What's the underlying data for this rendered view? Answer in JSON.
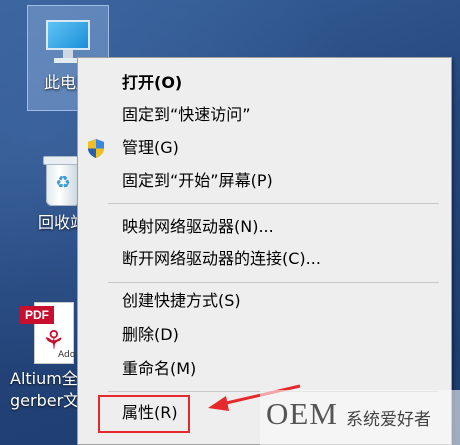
{
  "desktop": {
    "icons": [
      {
        "label": "此电脑",
        "name": "this-pc"
      },
      {
        "label": "回收站",
        "name": "recycle-bin"
      },
      {
        "label": "Altium全",
        "label2": "gerber文",
        "name": "pdf-file",
        "badge": "PDF",
        "subtext": "Ado"
      }
    ]
  },
  "context_menu": {
    "items": [
      {
        "label": "打开(O)",
        "bold": true
      },
      {
        "label": "固定到“快速访问”"
      },
      {
        "label": "管理(G)",
        "icon": "uac-shield-icon"
      },
      {
        "label": "固定到“开始”屏幕(P)"
      },
      {
        "label": "映射网络驱动器(N)..."
      },
      {
        "label": "断开网络驱动器的连接(C)..."
      },
      {
        "label": "创建快捷方式(S)"
      },
      {
        "label": "删除(D)"
      },
      {
        "label": "重命名(M)"
      },
      {
        "label": "属性(R)",
        "highlighted": true
      }
    ]
  },
  "annotation": {
    "highlight_color": "#e5292c"
  },
  "watermark": {
    "brand": "OEM",
    "text": "系统爱好者"
  }
}
